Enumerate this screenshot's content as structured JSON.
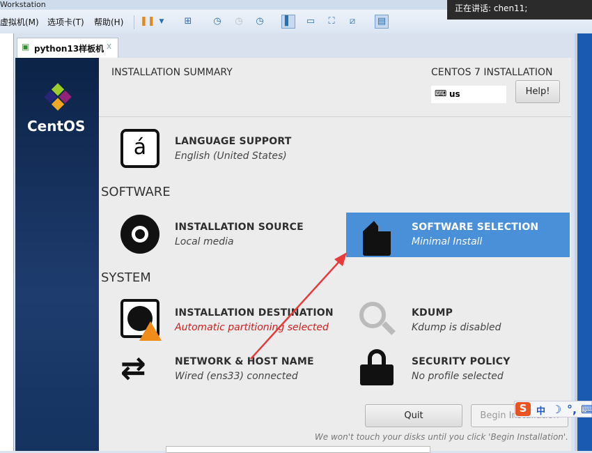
{
  "window": {
    "title": "Workstation",
    "menus": [
      "虚拟机(M)",
      "选项卡(T)",
      "帮助(H)"
    ],
    "notice": "正在讲话: chen11;"
  },
  "tab": {
    "label": "python13样板机",
    "close": "x"
  },
  "brand": {
    "logo_text": "CentOS"
  },
  "header": {
    "title": "INSTALLATION SUMMARY",
    "product": "CENTOS 7 INSTALLATION",
    "keyboard": "us",
    "help": "Help!"
  },
  "sections": {
    "software": "SOFTWARE",
    "system": "SYSTEM"
  },
  "spokes": {
    "language": {
      "title": "LANGUAGE SUPPORT",
      "sub": "English (United States)"
    },
    "source": {
      "title": "INSTALLATION SOURCE",
      "sub": "Local media"
    },
    "software": {
      "title": "SOFTWARE SELECTION",
      "sub": "Minimal Install"
    },
    "destination": {
      "title": "INSTALLATION DESTINATION",
      "sub": "Automatic partitioning selected"
    },
    "kdump": {
      "title": "KDUMP",
      "sub": "Kdump is disabled"
    },
    "network": {
      "title": "NETWORK & HOST NAME",
      "sub": "Wired (ens33) connected"
    },
    "security": {
      "title": "SECURITY POLICY",
      "sub": "No profile selected"
    }
  },
  "footer": {
    "quit": "Quit",
    "begin": "Begin Installation",
    "note": "We won't touch your disks until you click 'Begin Installation'."
  },
  "ime": {
    "lang": "中"
  },
  "colors": {
    "selected": "#4a90d9",
    "warning": "#cc2222",
    "arrow": "#e83a3a"
  }
}
